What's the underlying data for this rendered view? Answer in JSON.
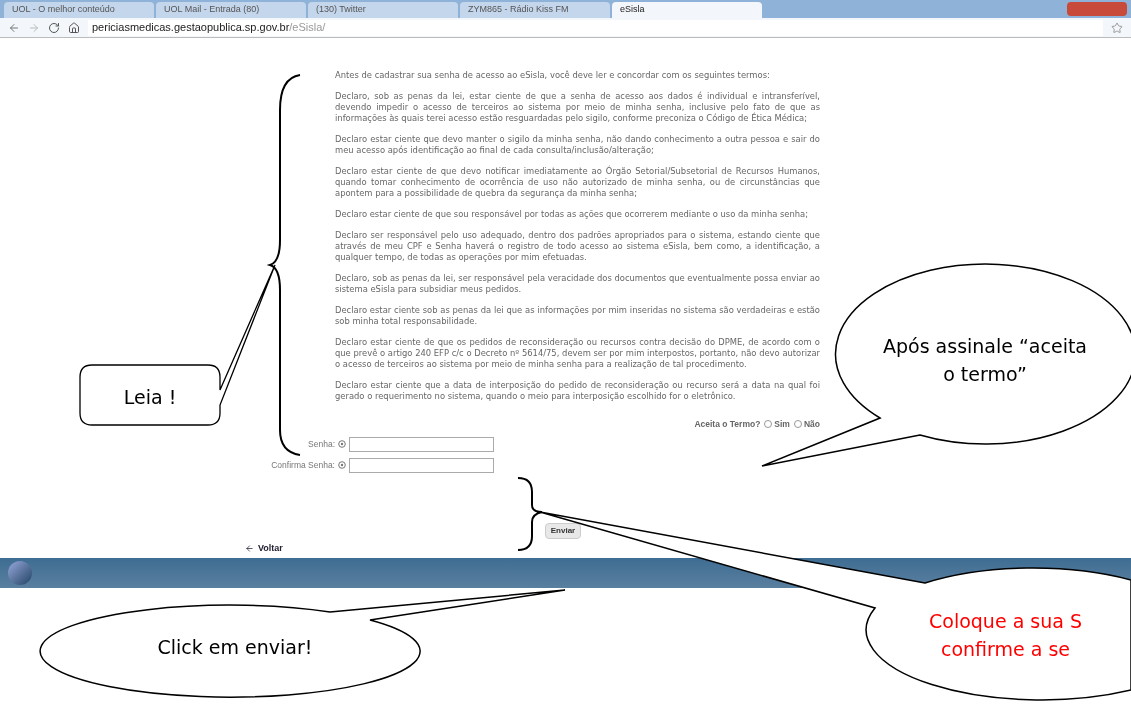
{
  "browser": {
    "tabs": [
      {
        "label": "UOL - O melhor conteúdo",
        "selected": false
      },
      {
        "label": "UOL Mail - Entrada (80)",
        "selected": false
      },
      {
        "label": "(130) Twitter",
        "selected": false
      },
      {
        "label": "ZYM865 - Rádio Kiss FM",
        "selected": false
      },
      {
        "label": "eSisla",
        "selected": true
      }
    ],
    "address": {
      "host": "periciasmedicas.gestaopublica.sp.gov.br",
      "path": "/eSisla/"
    }
  },
  "terms": [
    "Antes de cadastrar sua senha de acesso ao eSisla, você deve ler e concordar com os seguintes termos:",
    "Declaro, sob as penas da lei, estar ciente de que a senha de acesso aos dados é individual e intransferível, devendo impedir o acesso de terceiros ao sistema por meio de minha senha, inclusive pelo fato de que as informações às quais terei acesso estão resguardadas pelo sigilo, conforme preconiza o Código de Ética Médica;",
    "Declaro estar ciente que devo manter o sigilo da minha senha, não dando conhecimento a outra pessoa e sair do meu acesso após identificação ao final de cada consulta/inclusão/alteração;",
    "Declaro estar ciente de que devo notificar imediatamente ao Órgão Setorial/Subsetorial de Recursos Humanos, quando tomar conhecimento de ocorrência de uso não autorizado de minha senha, ou de circunstâncias que apontem para a possibilidade de quebra da segurança da minha senha;",
    "Declaro estar ciente de que sou responsável por todas as ações que ocorrerem mediante o uso da minha senha;",
    "Declaro ser responsável pelo uso adequado, dentro dos padrões apropriados para o sistema, estando ciente que através de meu CPF e Senha haverá o registro de todo acesso ao sistema eSisla, bem como, a identificação, a qualquer tempo, de todas as operações por mim efetuadas.",
    "Declaro, sob as penas da lei, ser responsável pela veracidade dos documentos que eventualmente possa enviar ao sistema eSisla para subsidiar meus pedidos.",
    "Declaro estar ciente sob as penas da lei que as informações por mim inseridas no sistema são verdadeiras e estão sob minha total responsabilidade.",
    "Declaro estar ciente de que os pedidos de reconsideração ou recursos contra decisão do DPME, de acordo com o que prevê o artigo 240 EFP c/c o Decreto nº 5614/75, devem ser por mim interpostos, portanto, não devo autorizar o acesso de terceiros ao sistema por meio de minha senha para a realização de tal procedimento.",
    "Declaro estar ciente que a data de interposição do pedido de reconsideração ou recurso será a data na qual foi gerado o requerimento no sistema, quando o meio para interposição escolhido for o eletrônico."
  ],
  "accept": {
    "label": "Aceita o Termo?",
    "options": [
      {
        "label": "Sim",
        "selected": false
      },
      {
        "label": "Não",
        "selected": false
      }
    ]
  },
  "fields": [
    {
      "label": "Senha:"
    },
    {
      "label": "Confirma Senha:"
    }
  ],
  "submit": "Enviar",
  "back": "Voltar",
  "callouts": [
    {
      "kind": "note",
      "lines": [
        "Leia !"
      ]
    },
    {
      "kind": "bubble_top",
      "lines": [
        "Após assinale “aceita",
        "o termo”"
      ]
    },
    {
      "kind": "bubble_left",
      "lines": [
        "Click em enviar!"
      ]
    },
    {
      "kind": "bubble_right",
      "lines": [
        "Coloque a sua S",
        "confirme a se"
      ]
    }
  ]
}
